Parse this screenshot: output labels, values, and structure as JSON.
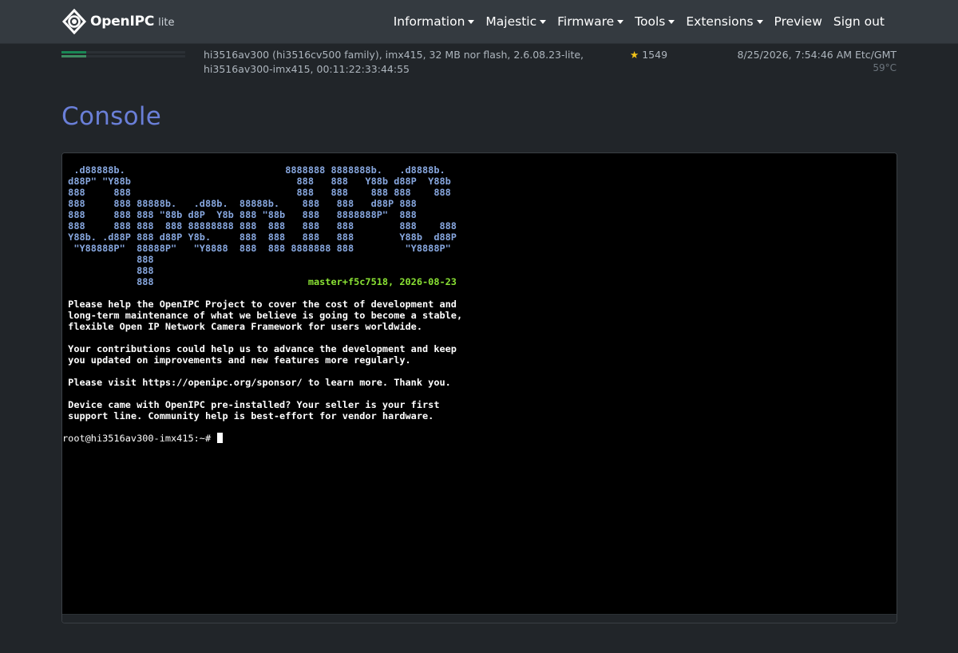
{
  "brand": {
    "name": "OpenIPC",
    "sub": "lite",
    "logo_icon": "openipc-logo-icon"
  },
  "nav": [
    {
      "label": "Information",
      "dropdown": true
    },
    {
      "label": "Majestic",
      "dropdown": true
    },
    {
      "label": "Firmware",
      "dropdown": true
    },
    {
      "label": "Tools",
      "dropdown": true
    },
    {
      "label": "Extensions",
      "dropdown": true
    },
    {
      "label": "Preview",
      "dropdown": false
    },
    {
      "label": "Sign out",
      "dropdown": false
    }
  ],
  "status": {
    "device_info": "hi3516av300 (hi3516cv500 family), imx415, 32 MB nor flash, 2.6.08.23-lite, hi3516av300-imx415, 00:11:22:33:44:55",
    "stars": "1549",
    "star_icon": "star-icon",
    "datetime": "8/25/2026, 7:54:46 AM Etc/GMT",
    "temperature": "59°C",
    "memory_usage_fraction": 0.2,
    "overlay_usage_fraction": 0.2,
    "bar_color": "#198754"
  },
  "page": {
    "title": "Console"
  },
  "console": {
    "ascii_art": [
      "  .d88888b.                            8888888 8888888b.   .d8888b. ",
      " d88P\" \"Y88b                             888   888   Y88b d88P  Y88b",
      " 888     888                             888   888    888 888    888",
      " 888     888 88888b.   .d88b.  88888b.    888   888   d88P 888       ",
      " 888     888 888 \"88b d8P  Y8b 888 \"88b   888   8888888P\"  888       ",
      " 888     888 888  888 88888888 888  888   888   888        888    888",
      " Y88b. .d88P 888 d88P Y8b.     888  888   888   888        Y88b  d88P",
      "  \"Y88888P\"  88888P\"   \"Y8888  888  888 8888888 888         \"Y8888P\" ",
      "             888",
      "             888",
      "             888                           "
    ],
    "version": "master+f5c7518, 2026-08-23",
    "message_lines": [
      "",
      " Please help the OpenIPC Project to cover the cost of development and",
      " long-term maintenance of what we believe is going to become a stable,",
      " flexible Open IP Network Camera Framework for users worldwide.",
      "",
      " Your contributions could help us to advance the development and keep",
      " you updated on improvements and new features more regularly.",
      "",
      " Please visit https://openipc.org/sponsor/ to learn more. Thank you.",
      "",
      " Device came with OpenIPC pre-installed? Your seller is your first",
      " support line. Community help is best-effort for vendor hardware.",
      ""
    ],
    "prompt": "root@hi3516av300-imx415:~# ",
    "colors": {
      "ascii": "#87a7df",
      "version": "#8ae234",
      "background": "#000000"
    }
  }
}
